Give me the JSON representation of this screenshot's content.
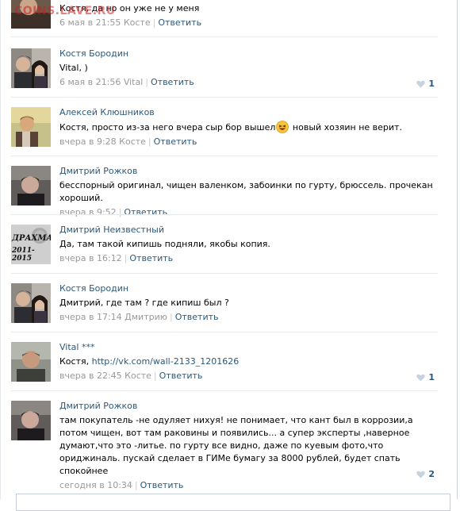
{
  "watermark": "COINS.LAVE.RU",
  "comments": [
    {
      "author": "",
      "text": "Костя, да но он уже не у меня",
      "date": "6 мая в 21:55",
      "reply_to": "Косте",
      "reply_label": "Ответить",
      "likes": null
    },
    {
      "author": "Костя Бородин",
      "text": "Vital, )",
      "date": "6 мая в 21:56",
      "reply_to": "Vital",
      "reply_label": "Ответить",
      "likes": "1"
    },
    {
      "author": "Алексей Клюшников",
      "text_before": "Костя, просто из-за него вчера сыр бор вышел",
      "text_after": " новый хозяин не верит.",
      "date": "вчера в 9:28",
      "reply_to": "Косте",
      "reply_label": "Ответить",
      "likes": null
    },
    {
      "author": "Дмитрий Рожков",
      "text": "бесспорный оригинал, чищен валенком, забоинки по гурту, брюссель. прочекан хороший.",
      "date": "вчера в 9:52",
      "reply_to": "",
      "reply_label": "Ответить",
      "likes": null
    },
    {
      "author": "Дмитрий Неизвестный",
      "avatar_text_1": "ДРАХМА",
      "avatar_text_2": "2011-2015",
      "text": "Да, там такой кипишь подняли, якобы копия.",
      "date": "вчера в 16:12",
      "reply_to": "",
      "reply_label": "Ответить",
      "likes": null
    },
    {
      "author": "Костя Бородин",
      "text": "Дмитрий, где там ? где кипиш был ?",
      "date": "вчера в 17:14",
      "reply_to": "Дмитрию",
      "reply_label": "Ответить",
      "likes": null
    },
    {
      "author": "Vital ***",
      "text_prefix": "Костя, ",
      "link": "http://vk.com/wall-2133_1201626",
      "date": "вчера в 22:45",
      "reply_to": "Косте",
      "reply_label": "Ответить",
      "likes": "1"
    },
    {
      "author": "Дмитрий Рожков",
      "text": "там покупатель -не одуляет нихуя! не понимает, что кант был в коррозии,а потом чищен, вот там раковины и появились... а супер эксперты ,наверное думают,что это -литье. по гурту все видно, даже по куевым фото,что ориджиналь. пускай сделает в ГИМе бумагу за 8000 рублей, будет спать спокойнее",
      "date": "сегодня в 10:34",
      "reply_to": "",
      "reply_label": "Ответить",
      "likes": "2"
    }
  ],
  "colors": {
    "link": "#2b587a",
    "meta": "#999999",
    "separator": "#e7eaed",
    "watermark": "#c81e1e"
  }
}
